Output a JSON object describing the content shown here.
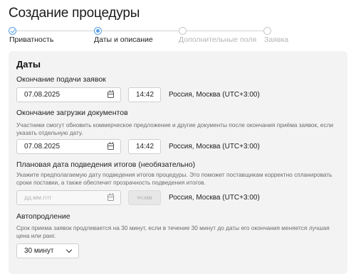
{
  "page": {
    "title": "Создание процедуры"
  },
  "stepper": {
    "steps": [
      {
        "label": "Приватность",
        "state": "done"
      },
      {
        "label": "Даты и описание",
        "state": "current"
      },
      {
        "label": "Дополнительные поля",
        "state": "upcoming"
      },
      {
        "label": "Заявка",
        "state": "upcoming"
      }
    ],
    "accent_color": "#5aa0e8"
  },
  "dates": {
    "title": "Даты",
    "submission_end": {
      "label": "Окончание подачи заявок",
      "date": "07.08.2025",
      "time": "14:42",
      "timezone": "Россия, Москва (UTC+3:00)"
    },
    "documents_end": {
      "label": "Окончание загрузки документов",
      "hint": "Участники смогут обновить коммерческое предложение и другие документы после окончания приёма заявок, если указать отдельную дату.",
      "date": "07.08.2025",
      "time": "14:42",
      "timezone": "Россия, Москва (UTC+3:00)"
    },
    "results_date": {
      "label": "Плановая дата подведения итогов (необязательно)",
      "hint": "Укажите предполагаемую дату подведения итогов процедуры. Это поможет поставщикам корректно спланировать сроки поставки, а также обеспечит прозрачность подведения итогов.",
      "date_placeholder": "дд.мм.гггг",
      "time_placeholder": "чч:мм",
      "timezone": "Россия, Москва (UTC+3:00)"
    },
    "auto_extend": {
      "label": "Автопродление",
      "hint": "Срок приема заявок продлевается на 30 минут, если в течение 30 минут до даты его окончания меняется лучшая цена или ранг.",
      "selected": "30 минут"
    }
  }
}
